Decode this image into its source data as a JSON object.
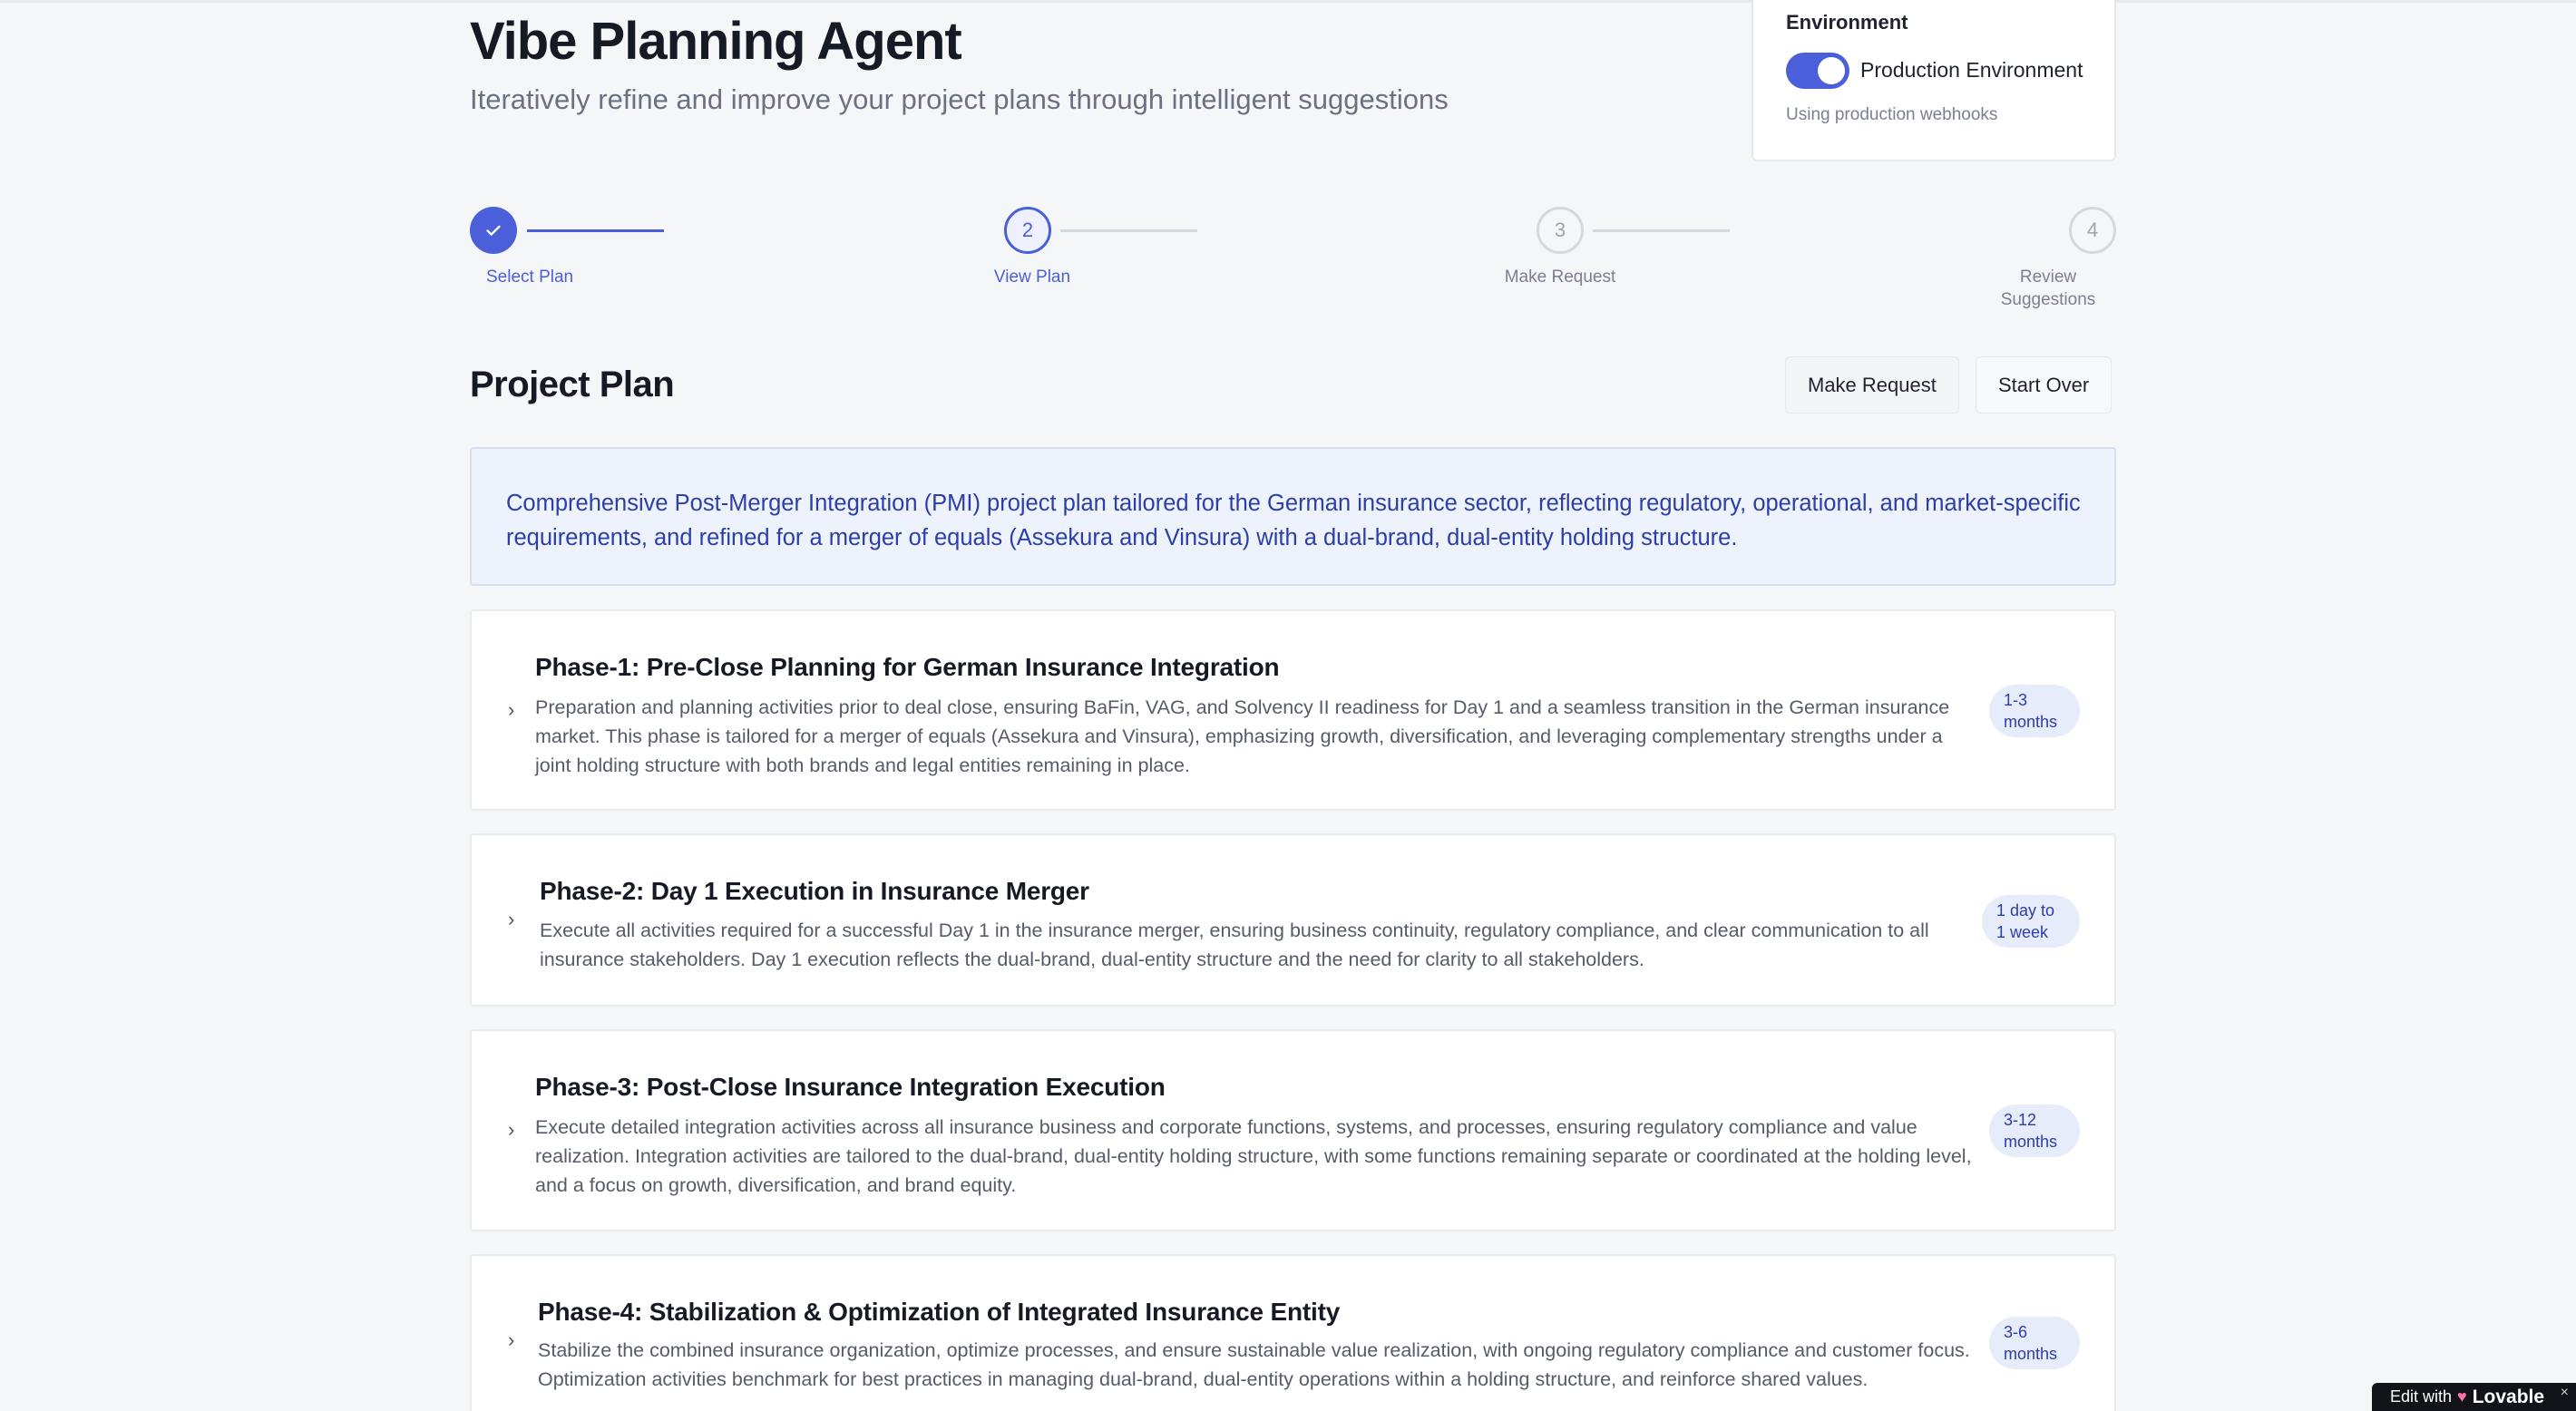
{
  "header": {
    "title": "Vibe Planning Agent",
    "subtitle": "Iteratively refine and improve your project plans through intelligent suggestions"
  },
  "environment": {
    "label": "Environment",
    "toggle_on": true,
    "name": "Production Environment",
    "note": "Using production webhooks",
    "accent": "#4a5fd9"
  },
  "stepper": {
    "steps": [
      {
        "number": "",
        "icon": "check-icon",
        "label": "Select Plan",
        "state": "done"
      },
      {
        "number": "2",
        "label": "View Plan",
        "state": "active"
      },
      {
        "number": "3",
        "label": "Make Request",
        "state": "todo"
      },
      {
        "number": "4",
        "label": "Review Suggestions",
        "label_line1": "Review",
        "label_line2": "Suggestions",
        "state": "todo"
      }
    ]
  },
  "plan": {
    "title": "Project Plan",
    "make_request_label": "Make Request",
    "start_over_label": "Start Over",
    "summary": "Comprehensive Post-Merger Integration (PMI) project plan tailored for the German insurance sector, reflecting regulatory, operational, and market-specific requirements, and refined for a merger of equals (Assekura and Vinsura) with a dual-brand, dual-entity holding structure.",
    "phases": [
      {
        "title": "Phase-1: Pre-Close Planning for German Insurance Integration",
        "description": "Preparation and planning activities prior to deal close, ensuring BaFin, VAG, and Solvency II readiness for Day 1 and a seamless transition in the German insurance market. This phase is tailored for a merger of equals (Assekura and Vinsura), emphasizing growth, diversification, and leveraging complementary strengths under a joint holding structure with both brands and legal entities remaining in place.",
        "duration_line1": "1-3",
        "duration_line2": "months"
      },
      {
        "title": "Phase-2: Day 1 Execution in Insurance Merger",
        "description": "Execute all activities required for a successful Day 1 in the insurance merger, ensuring business continuity, regulatory compliance, and clear communication to all insurance stakeholders. Day 1 execution reflects the dual-brand, dual-entity structure and the need for clarity to all stakeholders.",
        "duration_line1": "1 day to",
        "duration_line2": "1 week"
      },
      {
        "title": "Phase-3: Post-Close Insurance Integration Execution",
        "description": "Execute detailed integration activities across all insurance business and corporate functions, systems, and processes, ensuring regulatory compliance and value realization. Integration activities are tailored to the dual-brand, dual-entity holding structure, with some functions remaining separate or coordinated at the holding level, and a focus on growth, diversification, and brand equity.",
        "duration_line1": "3-12",
        "duration_line2": "months"
      },
      {
        "title": "Phase-4: Stabilization & Optimization of Integrated Insurance Entity",
        "description": "Stabilize the combined insurance organization, optimize processes, and ensure sustainable value realization, with ongoing regulatory compliance and customer focus. Optimization activities benchmark for best practices in managing dual-brand, dual-entity operations within a holding structure, and reinforce shared values.",
        "duration_line1": "3-6",
        "duration_line2": "months"
      }
    ]
  },
  "badge": {
    "prefix": "Edit with",
    "brand": "Lovable",
    "close": "×"
  }
}
